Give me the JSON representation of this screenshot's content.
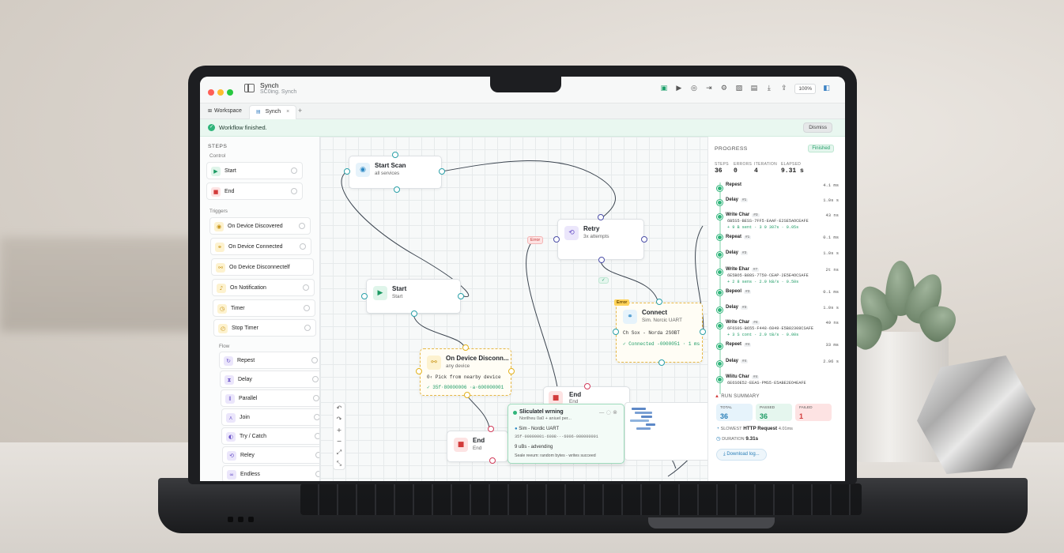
{
  "window": {
    "title": "Synch",
    "subtitle": "SC0ing. Synch"
  },
  "toolbar": {
    "zoom": "100%",
    "icons": [
      "save-icon",
      "play-icon",
      "record-icon",
      "step-icon",
      "debug-icon",
      "image-icon",
      "film-icon",
      "download-icon",
      "share-icon",
      "panel-icon"
    ]
  },
  "tabs": [
    {
      "label": "Workspace"
    },
    {
      "label": "Synch",
      "close": "×"
    }
  ],
  "tab_add": "+",
  "banner": {
    "text": "Workflow finished.",
    "button": "Dismiss"
  },
  "steps": {
    "title": "STEPS",
    "sections": {
      "control": "Control",
      "triggers": "Triggers",
      "flow": "Flow"
    },
    "control": [
      {
        "label": "Start",
        "icon": "play-icon"
      },
      {
        "label": "End",
        "icon": "stop-icon"
      }
    ],
    "triggers": [
      {
        "label": "On Device Discovered",
        "icon": "radar-icon"
      },
      {
        "label": "On Device Connected",
        "icon": "link-icon"
      },
      {
        "label": "Oo Device Disconnectelf",
        "icon": "unlink-icon"
      },
      {
        "label": "On Notification",
        "icon": "bell-icon"
      },
      {
        "label": "Timer",
        "icon": "timer-icon"
      },
      {
        "label": "Stop Timer",
        "icon": "timer-stop-icon"
      }
    ],
    "flow": [
      {
        "label": "Repest",
        "icon": "repeat-icon"
      },
      {
        "label": "Delay",
        "icon": "hourglass-icon"
      },
      {
        "label": "Parallel",
        "icon": "parallel-icon"
      },
      {
        "label": "Join",
        "icon": "join-icon"
      },
      {
        "label": "Try / Catch",
        "icon": "shield-icon"
      },
      {
        "label": "Reley",
        "icon": "retry-icon"
      },
      {
        "label": "Endless",
        "icon": "infinity-icon"
      }
    ]
  },
  "canvas": {
    "nodes": {
      "start_scan": {
        "title": "Start Scan",
        "sub": "all services"
      },
      "retry": {
        "title": "Retry",
        "sub": "3x attempts"
      },
      "start": {
        "title": "Start",
        "sub": "Start"
      },
      "connect": {
        "title": "Connect",
        "sub": "Sim. Norcic UART",
        "line1": "Ch  Sox - Norda 2S0BT",
        "line2": "✓ Connected  -0000051  · 1 ms",
        "tag": "Error"
      },
      "disconnect": {
        "title": "On Device Disconn...",
        "sub": "any device",
        "line1": "0‹  Pick from nearby device",
        "line2": "✓ 35f·80000006 ·a·600000001"
      },
      "end_a": {
        "title": "End",
        "sub": "End"
      },
      "end_b": {
        "title": "End",
        "sub": "End"
      }
    },
    "error_chip": "Error",
    "edge_chip": "✓",
    "toast": {
      "title": "Sliculatel wrning",
      "sub": "Norilheu 0a0 + aniuel per...",
      "row1": "Sim - Nordic UART",
      "row2": "35f·00000001·6008···6006-000000001",
      "row3": "9  uBs - advending",
      "row4": "Seale reeum: random bytes - writes succeed"
    },
    "zoom_controls": [
      "↶",
      "↷",
      "+",
      "−",
      "⤢",
      "⤡"
    ]
  },
  "progress": {
    "title": "PROGRESS",
    "badge": "Finished",
    "stats": [
      {
        "k": "STEPS",
        "v": "36"
      },
      {
        "k": "ERRORS",
        "v": "0"
      },
      {
        "k": "ITERATION",
        "v": "4"
      },
      {
        "k": "ELAPSED",
        "v": "9.31 s"
      }
    ],
    "events": [
      {
        "name": "Repest",
        "pill": "",
        "time": "4.1 ms"
      },
      {
        "name": "Delay",
        "pill": "#1",
        "time": "1.0s s"
      },
      {
        "name": "Write Char",
        "pill": "#3",
        "time": "43 ns",
        "d1": "6B5S5·BESS·7FF5·EAAF·E2SE5AOCEAFE",
        "d2": "+ 9 B sent · 3 9 307s · 0.05s"
      },
      {
        "name": "Repeat",
        "pill": "#1",
        "time": "0.1 ms"
      },
      {
        "name": "Delay",
        "pill": "#3",
        "time": "1.0s s"
      },
      {
        "name": "Write Ehar",
        "pill": "#7",
        "time": "2t ns",
        "d1": "6E5BO5·B88S·7T50·CEAP·2E5E4OCSAFE",
        "d2": "+ 2 8 sens · 2.9 kB/s · 0.50s"
      },
      {
        "name": "Bepeol",
        "pill": "#3",
        "time": "0.1 ms"
      },
      {
        "name": "Delay",
        "pill": "#3",
        "time": "1.0s s"
      },
      {
        "name": "Write Char",
        "pill": "#4",
        "time": "49 ns",
        "d1": "6F6S0S·B655·F448·6849·E5B82308CSAFE",
        "d2": "+ 3 S cont · 2.9 tB/s · 0.00s"
      },
      {
        "name": "Repeet",
        "pill": "#4",
        "time": "33 ms"
      },
      {
        "name": "Delay",
        "pill": "#4",
        "time": "2.06 s"
      },
      {
        "name": "Wiitu Char",
        "pill": "#4",
        "time": ""
      }
    ],
    "last_detail": "6E6SOE52·EEAS·PMS5·E5ABE2EO4EAFE",
    "summary_title": "RUN SUMMARY",
    "cards": [
      {
        "k": "TOTAL",
        "v": "36"
      },
      {
        "k": "PASSED",
        "v": "36"
      },
      {
        "k": "FAILED",
        "v": "1"
      }
    ],
    "slowest_label": "SLOWEST",
    "slowest_value": "HTTP Request",
    "slowest_time": "4.01ms",
    "duration_label": "DURATION",
    "duration_value": "9.31s",
    "download": "Download log..."
  },
  "colors": {
    "accent_green": "#2fb57a",
    "error_red": "#d23b3b",
    "warning_yellow": "#e7b846",
    "link_blue": "#2a7fb8"
  }
}
